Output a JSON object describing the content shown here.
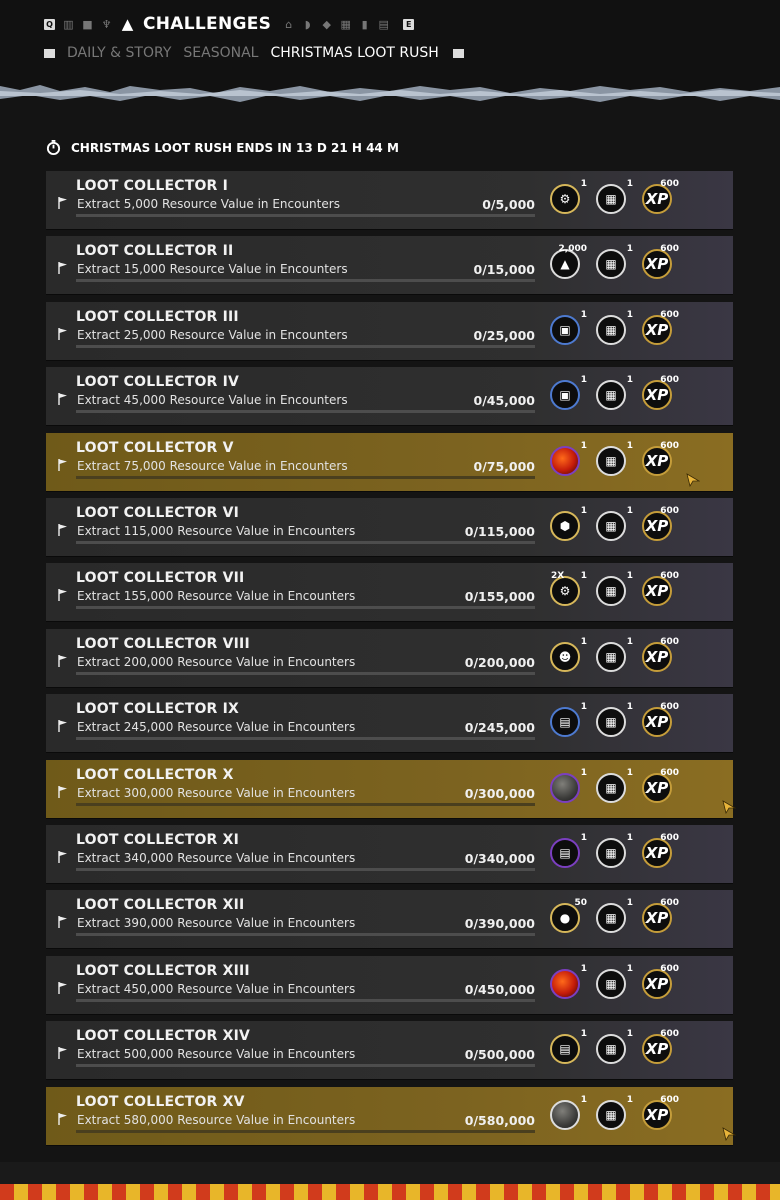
{
  "header": {
    "left_key": "Q",
    "right_key": "E",
    "title": "CHALLENGES",
    "tabs": [
      {
        "label": "DAILY & STORY",
        "active": false
      },
      {
        "label": "SEASONAL",
        "active": false
      },
      {
        "label": "CHRISTMAS LOOT RUSH",
        "active": true
      }
    ]
  },
  "event_banner": {
    "text": "CHRISTMAS LOOT RUSH ENDS IN 13 D 21 H 44 M"
  },
  "colors": {
    "highlight": "#7c6320",
    "card": "#2f2f2f",
    "rarity_legendary": "#d6b75a",
    "rarity_blue": "#4d7ad0",
    "rarity_purple": "#7b3fc0"
  },
  "challenges": [
    {
      "title": "LOOT COLLECTOR I",
      "desc": "Extract 5,000 Resource Value in Encounters",
      "progress": "0/5,000",
      "reward_icon": "gear-badge-icon",
      "reward_count": "1",
      "xp_count": "600",
      "xp_label": "XP",
      "crate_count": "1",
      "highlighted": false
    },
    {
      "title": "LOOT COLLECTOR II",
      "desc": "Extract 15,000 Resource Value in Encounters",
      "progress": "0/15,000",
      "reward_icon": "scrap-icon",
      "reward_count": "2,000",
      "xp_count": "600",
      "xp_label": "XP",
      "crate_count": "1",
      "highlighted": false
    },
    {
      "title": "LOOT COLLECTOR III",
      "desc": "Extract 25,000 Resource Value in Encounters",
      "progress": "0/25,000",
      "reward_icon": "crate-bomb-icon",
      "reward_count": "1",
      "xp_count": "600",
      "xp_label": "XP",
      "crate_count": "1",
      "highlighted": false
    },
    {
      "title": "LOOT COLLECTOR IV",
      "desc": "Extract 45,000 Resource Value in Encounters",
      "progress": "0/45,000",
      "reward_icon": "weapon-crate-icon",
      "reward_count": "1",
      "xp_count": "600",
      "xp_label": "XP",
      "crate_count": "1",
      "highlighted": false
    },
    {
      "title": "LOOT COLLECTOR V",
      "desc": "Extract 75,000 Resource Value in Encounters",
      "progress": "0/75,000",
      "reward_icon": "fire-orb-icon",
      "reward_count": "1",
      "xp_count": "600",
      "xp_label": "XP",
      "crate_count": "1",
      "highlighted": true
    },
    {
      "title": "LOOT COLLECTOR VI",
      "desc": "Extract 115,000 Resource Value in Encounters",
      "progress": "0/115,000",
      "reward_icon": "box-upgrade-icon",
      "reward_count": "1",
      "xp_count": "600",
      "xp_label": "XP",
      "crate_count": "1",
      "highlighted": false
    },
    {
      "title": "LOOT COLLECTOR VII",
      "desc": "Extract 155,000 Resource Value in Encounters",
      "progress": "0/155,000",
      "reward_icon": "gear-badge-2x-icon",
      "reward_count": "1",
      "reward_prefix": "2X",
      "xp_count": "600",
      "xp_label": "XP",
      "crate_count": "1",
      "highlighted": false
    },
    {
      "title": "LOOT COLLECTOR VIII",
      "desc": "Extract 200,000 Resource Value in Encounters",
      "progress": "0/200,000",
      "reward_icon": "mask-icon",
      "reward_count": "1",
      "xp_count": "600",
      "xp_label": "XP",
      "crate_count": "1",
      "highlighted": false
    },
    {
      "title": "LOOT COLLECTOR IX",
      "desc": "Extract 245,000 Resource Value in Encounters",
      "progress": "0/245,000",
      "reward_icon": "chest-icon",
      "reward_count": "1",
      "xp_count": "600",
      "xp_label": "XP",
      "crate_count": "1",
      "highlighted": false
    },
    {
      "title": "LOOT COLLECTOR X",
      "desc": "Extract 300,000 Resource Value in Encounters",
      "progress": "0/300,000",
      "reward_icon": "dark-orb-icon",
      "reward_count": "1",
      "xp_count": "600",
      "xp_label": "XP",
      "crate_count": "1",
      "highlighted": true
    },
    {
      "title": "LOOT COLLECTOR XI",
      "desc": "Extract 340,000 Resource Value in Encounters",
      "progress": "0/340,000",
      "reward_icon": "chest-icon",
      "reward_count": "1",
      "xp_count": "600",
      "xp_label": "XP",
      "crate_count": "1",
      "highlighted": false
    },
    {
      "title": "LOOT COLLECTOR XII",
      "desc": "Extract 390,000 Resource Value in Encounters",
      "progress": "0/390,000",
      "reward_icon": "coins-icon",
      "reward_count": "50",
      "xp_count": "600",
      "xp_label": "XP",
      "crate_count": "1",
      "highlighted": false
    },
    {
      "title": "LOOT COLLECTOR XIII",
      "desc": "Extract 450,000 Resource Value in Encounters",
      "progress": "0/450,000",
      "reward_icon": "fire-orb-icon",
      "reward_count": "1",
      "xp_count": "600",
      "xp_label": "XP",
      "crate_count": "1",
      "highlighted": false
    },
    {
      "title": "LOOT COLLECTOR XIV",
      "desc": "Extract 500,000 Resource Value in Encounters",
      "progress": "0/500,000",
      "reward_icon": "chest-icon",
      "reward_count": "1",
      "xp_count": "600",
      "xp_label": "XP",
      "crate_count": "1",
      "highlighted": false
    },
    {
      "title": "LOOT COLLECTOR XV",
      "desc": "Extract 580,000 Resource Value in Encounters",
      "progress": "0/580,000",
      "reward_icon": "stone-orb-icon",
      "reward_count": "1",
      "xp_count": "600",
      "xp_label": "XP",
      "crate_count": "1",
      "highlighted": true
    }
  ]
}
